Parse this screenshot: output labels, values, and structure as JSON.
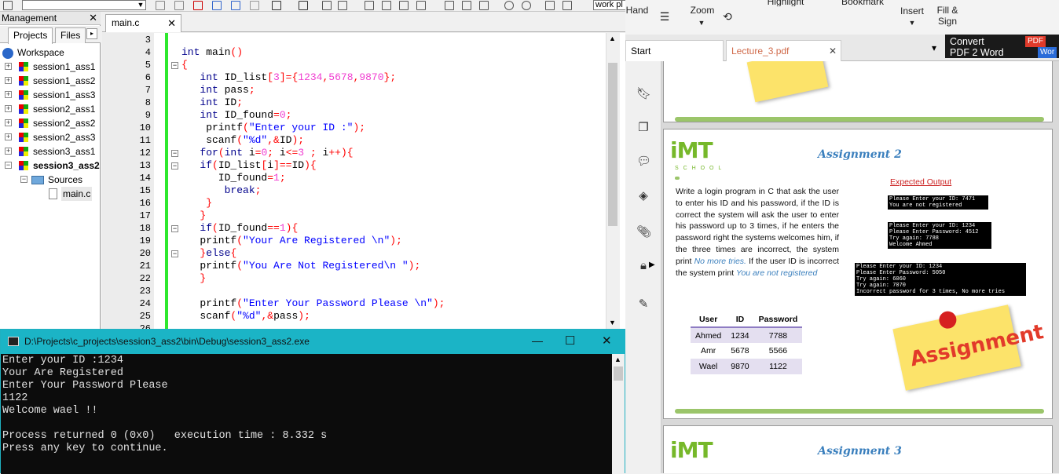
{
  "toolbar": {
    "work_label": "work pl"
  },
  "management": {
    "title": "Management",
    "close": "✕",
    "tabs": [
      "Projects",
      "Files"
    ],
    "tab_arrow": "▸",
    "workspace": "Workspace",
    "projects": [
      "session1_ass1",
      "session1_ass2",
      "session1_ass3",
      "session2_ass1",
      "session2_ass2",
      "session2_ass3",
      "session3_ass1",
      "session3_ass2"
    ],
    "sources": "Sources",
    "file": "main.c"
  },
  "editor": {
    "tab_label": "main.c",
    "tab_close": "✕",
    "line_numbers": [
      "3",
      "4",
      "5",
      "6",
      "7",
      "8",
      "9",
      "10",
      "11",
      "12",
      "13",
      "14",
      "15",
      "16",
      "17",
      "18",
      "19",
      "20",
      "21",
      "22",
      "23",
      "24",
      "25",
      "26"
    ]
  },
  "console": {
    "title": "D:\\Projects\\c_projects\\session3_ass2\\bin\\Debug\\session3_ass2.exe",
    "minimize": "—",
    "maximize": "☐",
    "close": "✕",
    "lines": [
      "Enter your ID :1234",
      "Your Are Registered",
      "Enter Your Password Please",
      "1122",
      "Welcome wael !!",
      "",
      "Process returned 0 (0x0)   execution time : 8.332 s",
      "Press any key to continue."
    ]
  },
  "ribbon": {
    "hand": "Hand",
    "zoom": "Zoom",
    "highlight": "Highlight",
    "bookmark": "Bookmark",
    "insert": "Insert",
    "fill_sign_1": "Fill &",
    "fill_sign_2": "Sign"
  },
  "doc_tabs": {
    "start": "Start",
    "lecture": "Lecture_3.pdf",
    "close": "✕",
    "dropdown": "▾",
    "convert_1": "Convert",
    "convert_2": "PDF 2 Word",
    "pdf_badge": "PDF",
    "word_badge": "Wor"
  },
  "pdf": {
    "logo": "iMT",
    "school": "S C H O O L",
    "assignment2_title": "Assignment 2",
    "expected_output": "Expected Output",
    "para_1": "Write a login program in C that ask the user to enter his ID and his password, if the ID is correct the system will ask the user to enter his password up to 3 times, if he enters the password right the systems welcomes him, if the three times are incorrect, the system print ",
    "para_hl1": "No more tries.",
    "para_2": " If the user ID is incorrect the system print ",
    "para_hl2": "You are not registered",
    "out1": "Please Enter your ID: 7471\nYou are not registered",
    "out2": "Please Enter your ID: 1234\nPlease Enter Password: 4512\nTry again: 7788\nWelcome Ahmed",
    "out3": "Please Enter your ID: 1234\nPlease Enter Password: 5050\nTry again: 6060\nTry again: 7070\nIncorrect password for 3 times, No more tries",
    "table_headers": [
      "User",
      "ID",
      "Password"
    ],
    "table_rows": [
      [
        "Ahmed",
        "1234",
        "7788"
      ],
      [
        "Amr",
        "5678",
        "5566"
      ],
      [
        "Wael",
        "9870",
        "1122"
      ]
    ],
    "note_text": "Assignment",
    "assignment3_title": "Assignment 3"
  }
}
